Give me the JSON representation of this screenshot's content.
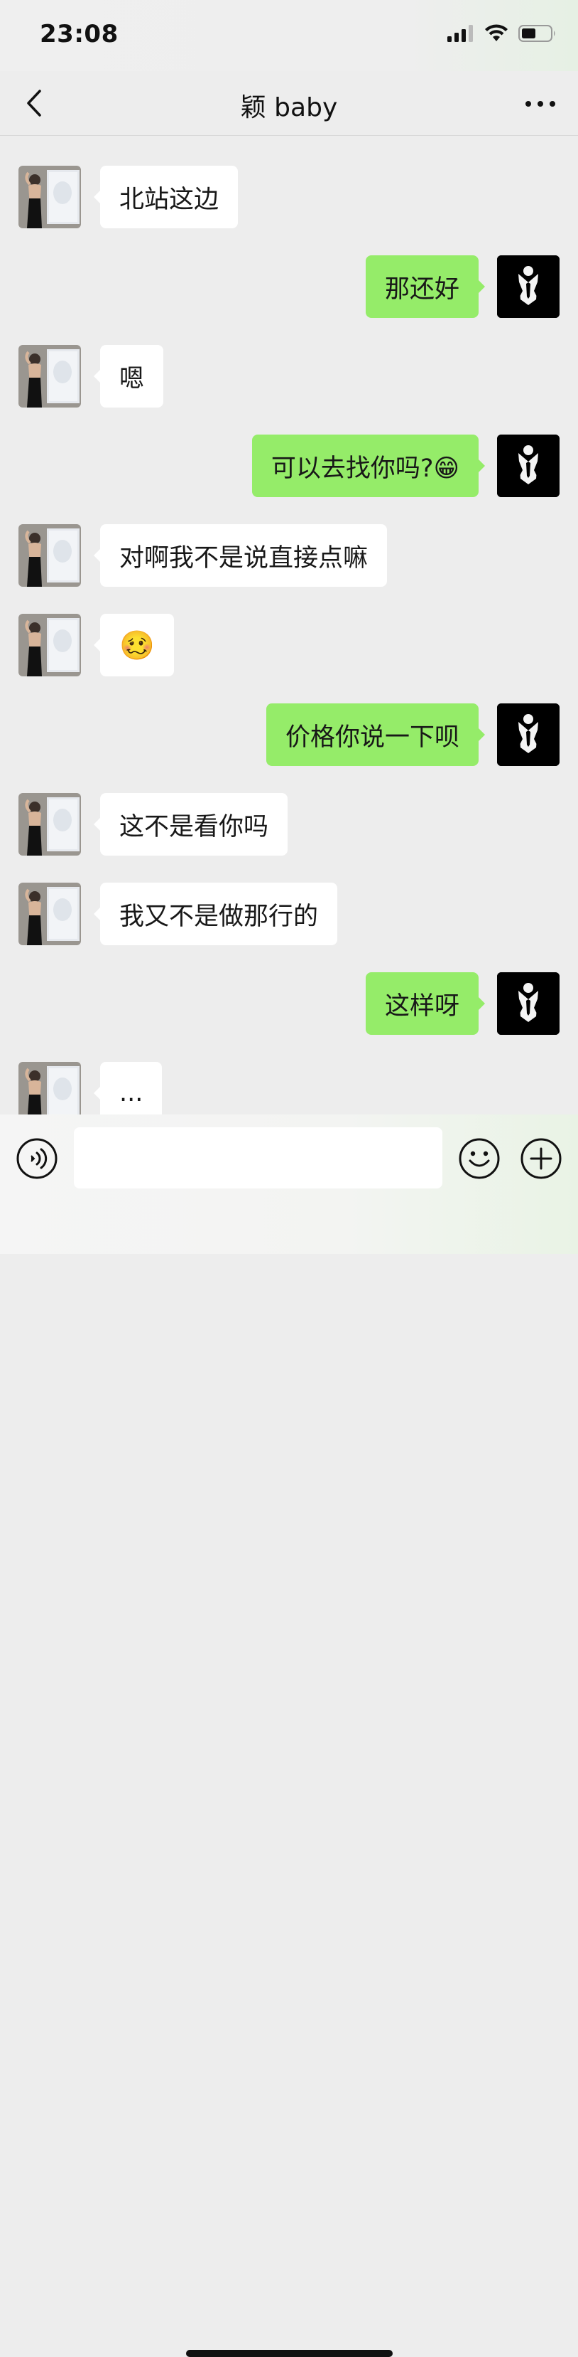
{
  "status_bar": {
    "time": "23:08",
    "battery_level": 0.5
  },
  "nav": {
    "title": "颖 baby",
    "back_icon": "chevron-left-icon",
    "more_icon": "ellipsis-icon"
  },
  "messages": [
    {
      "side": "left",
      "text": "北站这边"
    },
    {
      "side": "right",
      "text": "那还好"
    },
    {
      "side": "left",
      "text": "嗯"
    },
    {
      "side": "right",
      "text": "可以去找你吗?😁"
    },
    {
      "side": "left",
      "text": "对啊我不是说直接点嘛"
    },
    {
      "side": "left",
      "text": "🥴"
    },
    {
      "side": "right",
      "text": "价格你说一下呗"
    },
    {
      "side": "left",
      "text": "这不是看你吗"
    },
    {
      "side": "left",
      "text": "我又不是做那行的"
    },
    {
      "side": "right",
      "text": "这样呀"
    },
    {
      "side": "left",
      "text": "..."
    }
  ],
  "input": {
    "value": "",
    "placeholder": ""
  },
  "toolbar": {
    "voice_icon": "voice-icon",
    "emoji_icon": "emoji-icon",
    "plus_icon": "plus-icon"
  },
  "colors": {
    "sent_bubble": "#95ec69",
    "received_bubble": "#ffffff",
    "background": "#ededed"
  }
}
